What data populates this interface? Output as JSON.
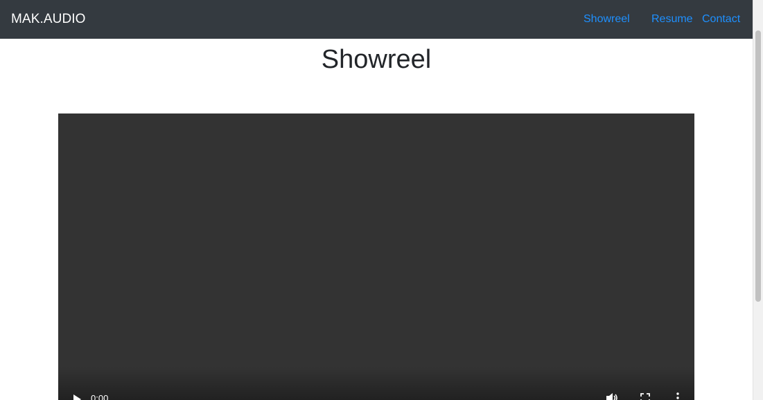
{
  "navbar": {
    "brand": "MAK.AUDIO",
    "links": [
      {
        "label": "Showreel"
      },
      {
        "label": "Resume"
      },
      {
        "label": "Contact"
      }
    ],
    "background_color": "#343a40",
    "link_color": "#1e90ff"
  },
  "main": {
    "title": "Showreel"
  },
  "video": {
    "time": "0:00",
    "background_color": "#333333",
    "controls": [
      "play-icon",
      "volume-icon",
      "fullscreen-icon",
      "more-icon"
    ]
  }
}
